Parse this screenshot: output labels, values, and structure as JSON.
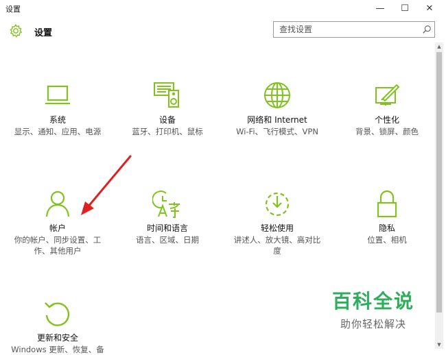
{
  "window": {
    "title": "设置",
    "minimize_glyph": "—",
    "maximize_glyph": "☐",
    "close_glyph": "✕"
  },
  "header": {
    "app_title": "设置",
    "icon": "gear-icon"
  },
  "search": {
    "placeholder": "查找设置",
    "icon": "search-icon"
  },
  "accent_color": "#7fc31c",
  "annotation_color": "#e02020",
  "categories": [
    {
      "name": "系统",
      "desc": "显示、通知、应用、电源",
      "icon": "laptop-icon"
    },
    {
      "name": "设备",
      "desc": "蓝牙、打印机、鼠标",
      "icon": "devices-icon"
    },
    {
      "name": "网络和 Internet",
      "desc": "Wi-Fi、飞行模式、VPN",
      "icon": "globe-icon"
    },
    {
      "name": "个性化",
      "desc": "背景、锁屏、颜色",
      "icon": "paint-icon"
    },
    {
      "name": "帐户",
      "desc": "你的帐户、同步设置、工作、其他用户",
      "icon": "person-icon"
    },
    {
      "name": "时间和语言",
      "desc": "语言、区域、日期",
      "icon": "time-language-icon"
    },
    {
      "name": "轻松使用",
      "desc": "讲述人、放大镜、高对比度",
      "icon": "ease-of-access-icon"
    },
    {
      "name": "隐私",
      "desc": "位置、相机",
      "icon": "lock-icon"
    },
    {
      "name": "更新和安全",
      "desc": "Windows 更新、恢复、备",
      "icon": "update-icon"
    }
  ],
  "watermark": {
    "title": "百科全说",
    "subtitle": "助你轻松解决"
  }
}
